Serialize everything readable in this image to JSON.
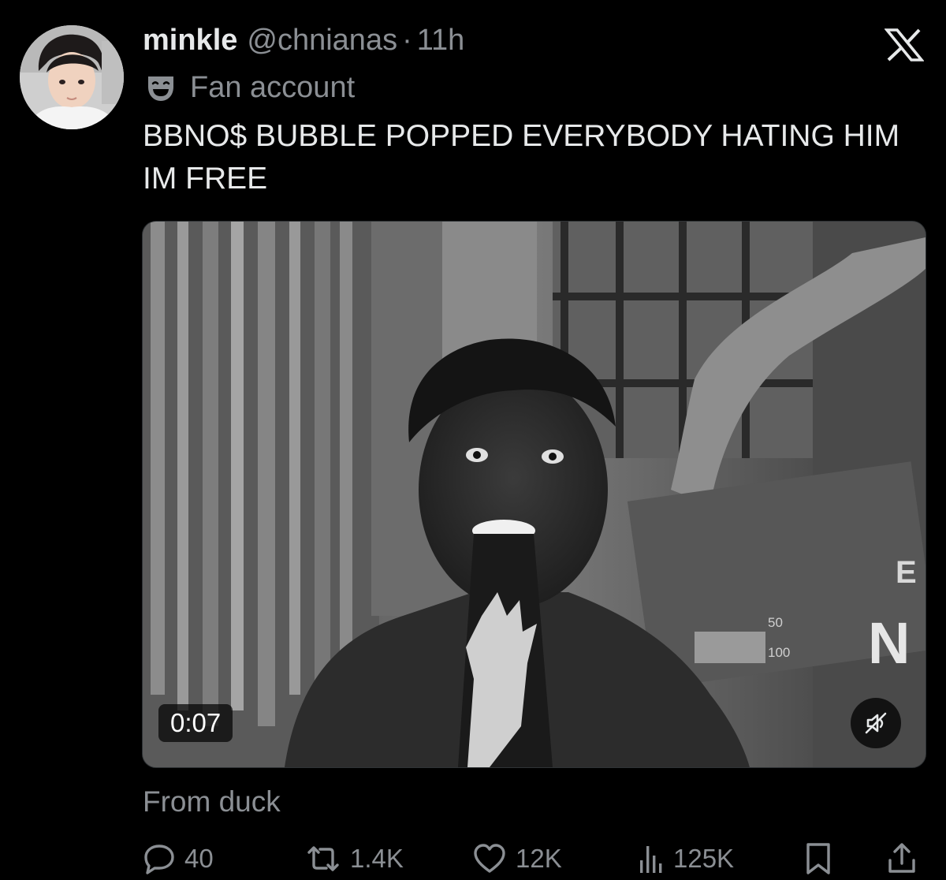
{
  "tweet": {
    "display_name": "minkle",
    "handle": "@chnianas",
    "separator": "·",
    "time": "11h",
    "affiliation_label": "Fan account",
    "text": "BBNO$ BUBBLE POPPED EVERYBODY HATING HIM IM FREE",
    "source_line": "From duck"
  },
  "video": {
    "duration": "0:07",
    "muted": true,
    "scoreboard_top": "50",
    "scoreboard_bottom": "100",
    "sign_text_top": "E",
    "sign_text_bottom": "N"
  },
  "actions": {
    "replies": "40",
    "reposts": "1.4K",
    "likes": "12K",
    "views": "125K"
  },
  "colors": {
    "background": "#000000",
    "text_primary": "#e7e9ea",
    "text_secondary": "#8b8f94",
    "border": "#2f3336"
  },
  "icons": {
    "brand": "x-logo-icon",
    "affiliation": "drama-mask-icon",
    "reply": "speech-bubble-icon",
    "repost": "repost-arrows-icon",
    "like": "heart-icon",
    "views": "bar-chart-icon",
    "bookmark": "bookmark-icon",
    "share": "share-icon",
    "mute": "speaker-muted-icon"
  }
}
